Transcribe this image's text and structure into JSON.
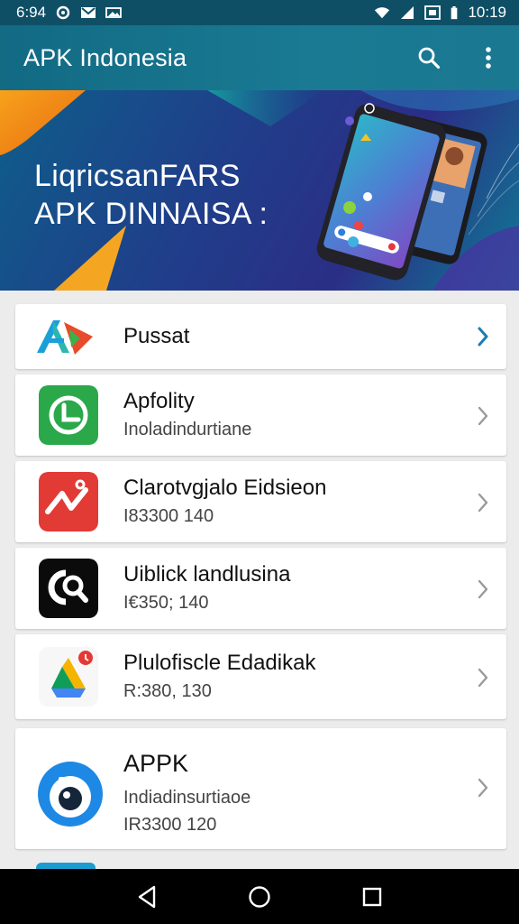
{
  "status_bar": {
    "time_left": "6:94",
    "time_right": "10:19"
  },
  "app_bar": {
    "title": "APK Indonesia",
    "search_icon": "search-icon",
    "menu_icon": "more-vert-icon"
  },
  "banner": {
    "line1": "LiqricsanFARS",
    "line2": "APK DINNAISA  :"
  },
  "list": [
    {
      "title": "Pussat",
      "subtitle": "",
      "icon": "apk-logo-icon",
      "chevron_color": "#1a7fb0"
    },
    {
      "title": "Apfolity",
      "subtitle": "Inoladindurtiane",
      "icon": "green-chat-app-icon",
      "chevron_color": "#9a9a9a"
    },
    {
      "title": "Clarotvgjalo Eidsieon",
      "subtitle": "I83300 140",
      "icon": "red-chart-app-icon",
      "chevron_color": "#9a9a9a"
    },
    {
      "title": "Uiblick landlusina",
      "subtitle": "I€350; 140",
      "icon": "black-search-app-icon",
      "chevron_color": "#9a9a9a"
    },
    {
      "title": "Plulofiscle Edadikak",
      "subtitle": "R:380, 130",
      "icon": "drive-app-icon",
      "chevron_color": "#9a9a9a"
    },
    {
      "title": "APPK",
      "subtitle": "Indiadinsurtiaoe",
      "subtitle2": "IR3300 120",
      "icon": "blue-camera-app-icon",
      "chevron_color": "#9a9a9a"
    }
  ],
  "nav_bar": {
    "back_icon": "back-icon",
    "home_icon": "home-icon",
    "recents_icon": "recents-icon"
  }
}
